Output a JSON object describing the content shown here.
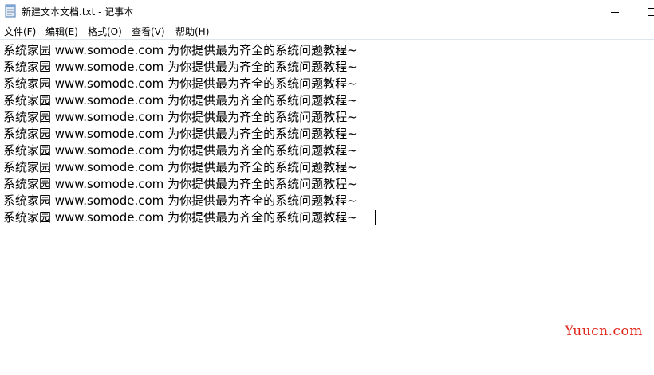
{
  "window": {
    "title": "新建文本文档.txt - 记事本",
    "icon": "notepad-icon",
    "controls": [
      "minimize-icon",
      "maximize-icon"
    ]
  },
  "menu": [
    "文件(F)",
    "编辑(E)",
    "格式(O)",
    "查看(V)",
    "帮助(H)"
  ],
  "editor": {
    "lines": [
      "系统家园 www.somode.com 为你提供最为齐全的系统问题教程~",
      "系统家园 www.somode.com 为你提供最为齐全的系统问题教程~",
      "系统家园 www.somode.com 为你提供最为齐全的系统问题教程~",
      "系统家园 www.somode.com 为你提供最为齐全的系统问题教程~",
      "系统家园 www.somode.com 为你提供最为齐全的系统问题教程~",
      "系统家园 www.somode.com 为你提供最为齐全的系统问题教程~",
      "系统家园 www.somode.com 为你提供最为齐全的系统问题教程~",
      "系统家园 www.somode.com 为你提供最为齐全的系统问题教程~",
      "系统家园 www.somode.com 为你提供最为齐全的系统问题教程~",
      "系统家园 www.somode.com 为你提供最为齐全的系统问题教程~",
      "系统家园 www.somode.com 为你提供最为齐全的系统问题教程~"
    ]
  },
  "watermark": "Yuucn.com",
  "colors": {
    "watermark": "#e0261b",
    "menu_border": "#dde7f0"
  }
}
